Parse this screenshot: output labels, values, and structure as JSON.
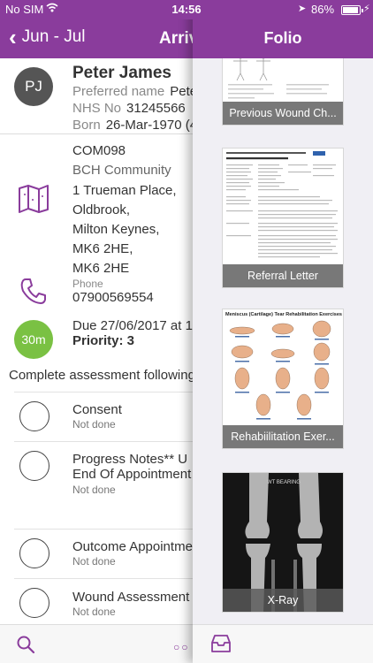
{
  "status_bar": {
    "carrier": "No SIM",
    "time": "14:56",
    "battery_pct": "86%",
    "battery_level": 0.86
  },
  "left": {
    "back_label": "Jun - Jul",
    "title": "Arriv",
    "patient": {
      "initials": "PJ",
      "name": "Peter James",
      "preferred_label": "Preferred name",
      "preferred_value": "Pete",
      "nhs_label": "NHS No",
      "nhs_value": "31245566",
      "born_label": "Born",
      "born_value": "26-Mar-1970 (4"
    },
    "location_code": "COM098",
    "location_name": "BCH Community",
    "address": [
      "1 Trueman Place,",
      "Oldbrook,",
      "Milton Keynes,",
      "MK6 2HE,",
      "MK6 2HE"
    ],
    "phone_label": "Phone",
    "phone_number": "07900569554",
    "duration": "30m",
    "due": "Due 27/06/2017 at 1",
    "priority": "Priority: 3",
    "instructions": "Complete assessment following",
    "tasks": [
      {
        "name": "Consent",
        "name2": "",
        "status": "Not done"
      },
      {
        "name": "Progress Notes**  U",
        "name2": "End Of Appointment",
        "status": "Not done"
      },
      {
        "name": "Outcome Appointme",
        "name2": "",
        "status": "Not done"
      },
      {
        "name": "Wound Assessment",
        "name2": "",
        "status": "Not done"
      }
    ]
  },
  "folio": {
    "title": "Folio",
    "documents": [
      {
        "caption": "Previous Wound Ch..."
      },
      {
        "caption": "Referral Letter"
      },
      {
        "caption": "Rehabiilitation Exer..."
      },
      {
        "caption": "X-Ray"
      }
    ],
    "rehab_title": "Meniscus (Cartilage) Tear Rehabilitation Exercises",
    "xray_label": "WT BEARING"
  },
  "colors": {
    "brand": "#8a3c9c",
    "duration_badge": "#7ac143",
    "avatar": "#555555"
  }
}
